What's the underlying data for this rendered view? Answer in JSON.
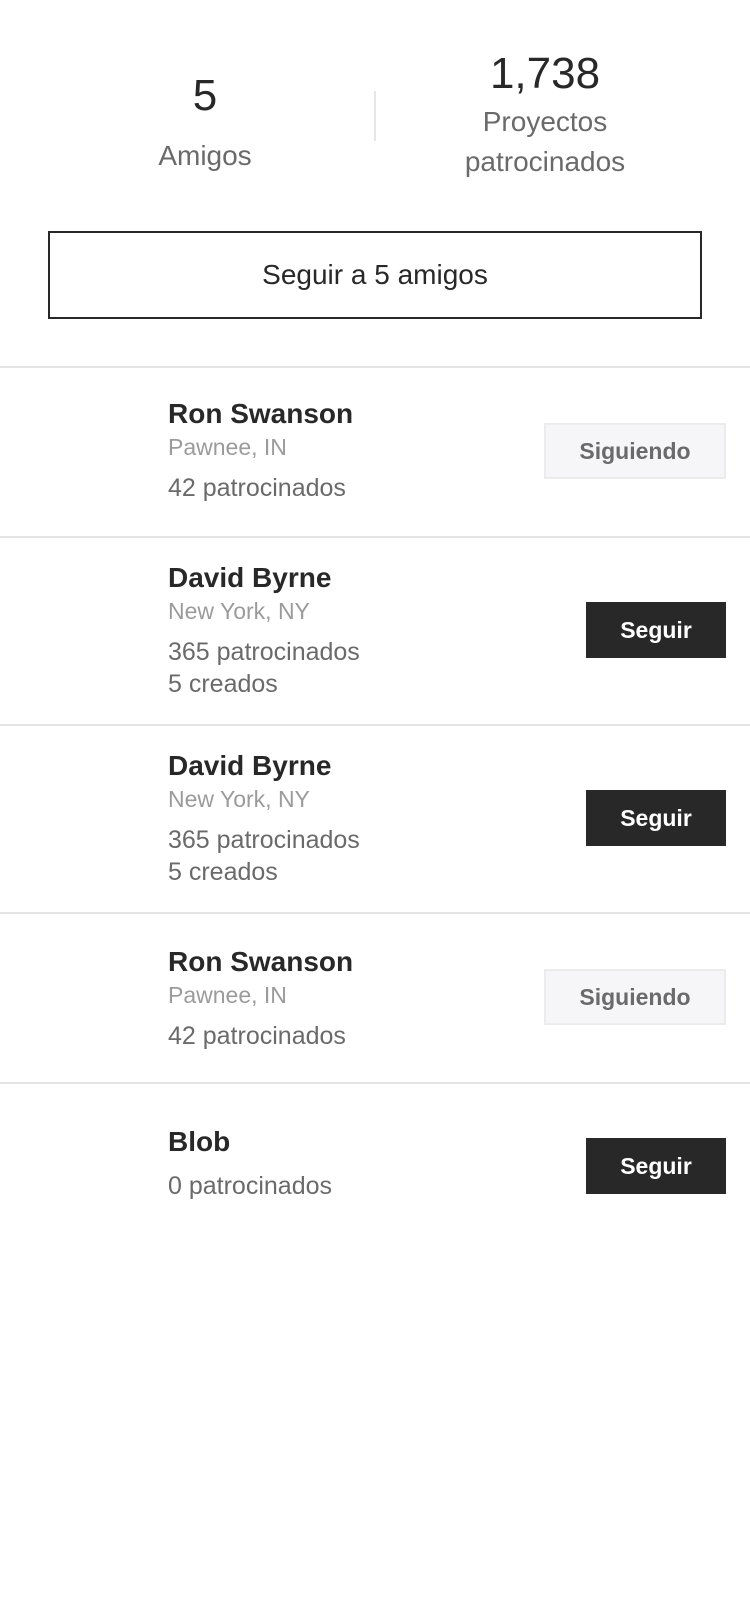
{
  "stats": {
    "friends_count": "5",
    "friends_label": "Amigos",
    "backed_count": "1,738",
    "backed_label_line1": "Proyectos",
    "backed_label_line2": "patrocinados"
  },
  "follow_all_label": "Seguir a 5 amigos",
  "friends": [
    {
      "name": "Ron Swanson",
      "location": "Pawnee, IN",
      "backed": "42 patrocinados",
      "created": "",
      "button": "Siguiendo",
      "following": true
    },
    {
      "name": "David Byrne",
      "location": "New York, NY",
      "backed": "365 patrocinados",
      "created": "5 creados",
      "button": "Seguir",
      "following": false
    },
    {
      "name": "David Byrne",
      "location": "New York, NY",
      "backed": "365 patrocinados",
      "created": "5 creados",
      "button": "Seguir",
      "following": false
    },
    {
      "name": "Ron Swanson",
      "location": "Pawnee, IN",
      "backed": "42 patrocinados",
      "created": "",
      "button": "Siguiendo",
      "following": true
    },
    {
      "name": "Blob",
      "location": "",
      "backed": "0 patrocinados",
      "created": "",
      "button": "Seguir",
      "following": false
    }
  ]
}
